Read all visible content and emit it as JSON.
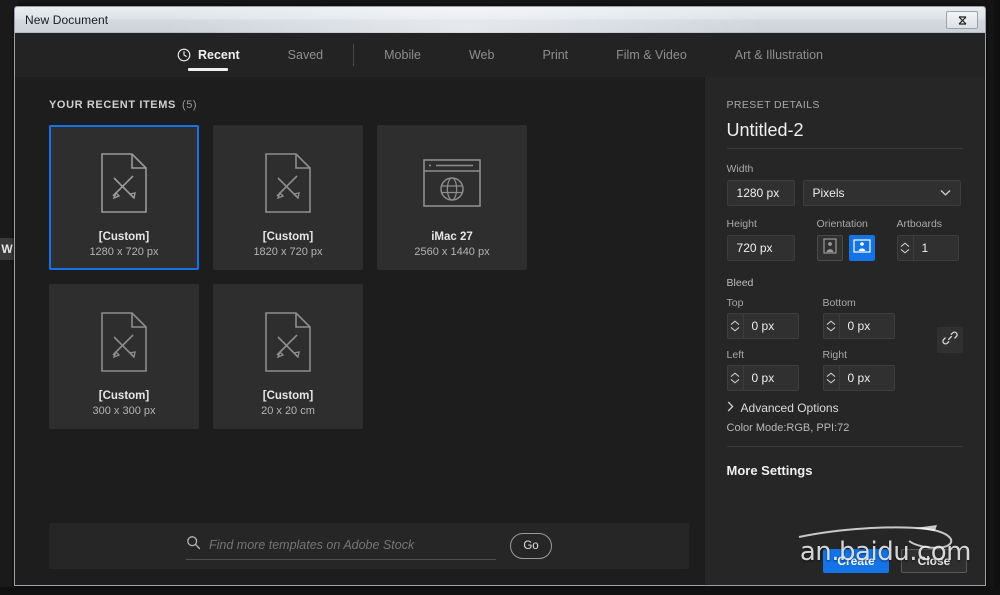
{
  "window": {
    "title": "New Document",
    "close_icon": "close-icon"
  },
  "tabs": [
    {
      "label": "Recent",
      "icon": "clock-icon",
      "active": true
    },
    {
      "label": "Saved",
      "active": false
    },
    {
      "label": "Mobile",
      "active": false
    },
    {
      "label": "Web",
      "active": false
    },
    {
      "label": "Print",
      "active": false
    },
    {
      "label": "Film & Video",
      "active": false
    },
    {
      "label": "Art & Illustration",
      "active": false
    }
  ],
  "recent": {
    "heading": "YOUR RECENT ITEMS",
    "count": "(5)",
    "items": [
      {
        "title": "[Custom]",
        "size": "1280 x 720 px",
        "icon": "document-tools-icon",
        "selected": true
      },
      {
        "title": "[Custom]",
        "size": "1820 x 720 px",
        "icon": "document-tools-icon",
        "selected": false
      },
      {
        "title": "iMac 27",
        "size": "2560 x 1440 px",
        "icon": "browser-globe-icon",
        "selected": false
      },
      {
        "title": "[Custom]",
        "size": "300 x 300 px",
        "icon": "document-tools-icon",
        "selected": false
      },
      {
        "title": "[Custom]",
        "size": "20 x 20 cm",
        "icon": "document-tools-icon",
        "selected": false
      }
    ]
  },
  "stock": {
    "placeholder": "Find more templates on Adobe Stock",
    "search_icon": "search-icon",
    "go_label": "Go"
  },
  "preset": {
    "section_label": "PRESET DETAILS",
    "name": "Untitled-2",
    "width_label": "Width",
    "width_value": "1280 px",
    "units_value": "Pixels",
    "height_label": "Height",
    "height_value": "720 px",
    "orientation_label": "Orientation",
    "orientation_portrait_icon": "orientation-portrait-icon",
    "orientation_landscape_icon": "orientation-landscape-icon",
    "artboards_label": "Artboards",
    "artboards_value": "1",
    "bleed_label": "Bleed",
    "bleed": [
      {
        "label": "Top",
        "value": "0 px"
      },
      {
        "label": "Bottom",
        "value": "0 px"
      },
      {
        "label": "Left",
        "value": "0 px"
      },
      {
        "label": "Right",
        "value": "0 px"
      }
    ],
    "link_icon": "link-chain-icon",
    "advanced_label": "Advanced Options",
    "advanced_arrow": "chevron-right-icon",
    "color_mode": "Color Mode:RGB, PPI:72",
    "more_settings": "More Settings"
  },
  "footer": {
    "create_label": "Create",
    "close_label": "Close"
  },
  "watermark": {
    "text": "an.baidu.com"
  },
  "background": {
    "fragment_text": "W"
  },
  "colors": {
    "accent": "#1473e6",
    "panel": "#262626",
    "canvas": "#1d1d1d",
    "card": "#2e2e2e",
    "text": "#f0f0f0"
  }
}
